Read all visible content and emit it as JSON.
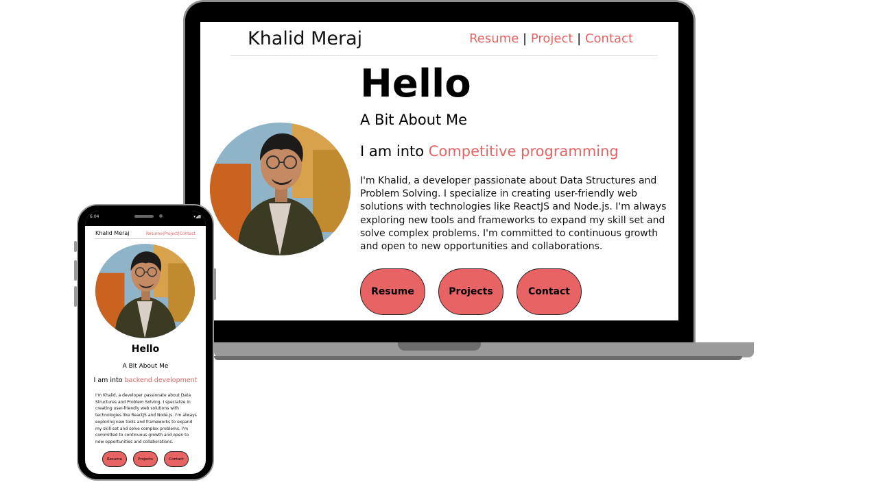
{
  "desktop": {
    "brand": "Khalid Meraj",
    "nav": {
      "resume": "Resume",
      "project": "Project",
      "contact": "Contact",
      "sep": "|"
    },
    "hello": "Hello",
    "subtitle": "A Bit About Me",
    "into_prefix": "I am into",
    "into_highlight": "Competitive programming",
    "paragraph": "I'm Khalid, a developer passionate about Data Structures and Problem Solving. I specialize in creating user-friendly web solutions with technologies like ReactJS and Node.js. I'm always exploring new tools and frameworks to expand my skill set and solve complex problems. I'm committed to continuous growth and open to new opportunities and collaborations.",
    "buttons": {
      "resume": "Resume",
      "projects": "Projects",
      "contact": "Contact"
    }
  },
  "mobile": {
    "status_time": "6:04",
    "brand": "Khalid Meraj",
    "nav": "Resume|Project|Contact",
    "hello": "Hello",
    "subtitle": "A Bit About Me",
    "into_prefix": "I am into",
    "into_highlight": "backend development",
    "paragraph": "I'm Khalid, a developer passionate about Data Structures and Problem Solving. I specialize in creating user-friendly web solutions with technologies like ReactJS and Node.js. I'm always exploring new tools and frameworks to expand my skill set and solve complex problems. I'm committed to continuous growth and open to new opportunities and collaborations.",
    "buttons": {
      "resume": "Resume",
      "projects": "Projects",
      "contact": "Contact"
    }
  },
  "colors": {
    "accent": "#e46464",
    "button": "#e86464",
    "device": "#000000",
    "frame": "#9a9a9a"
  },
  "icons": {
    "avatar": "profile-photo"
  }
}
